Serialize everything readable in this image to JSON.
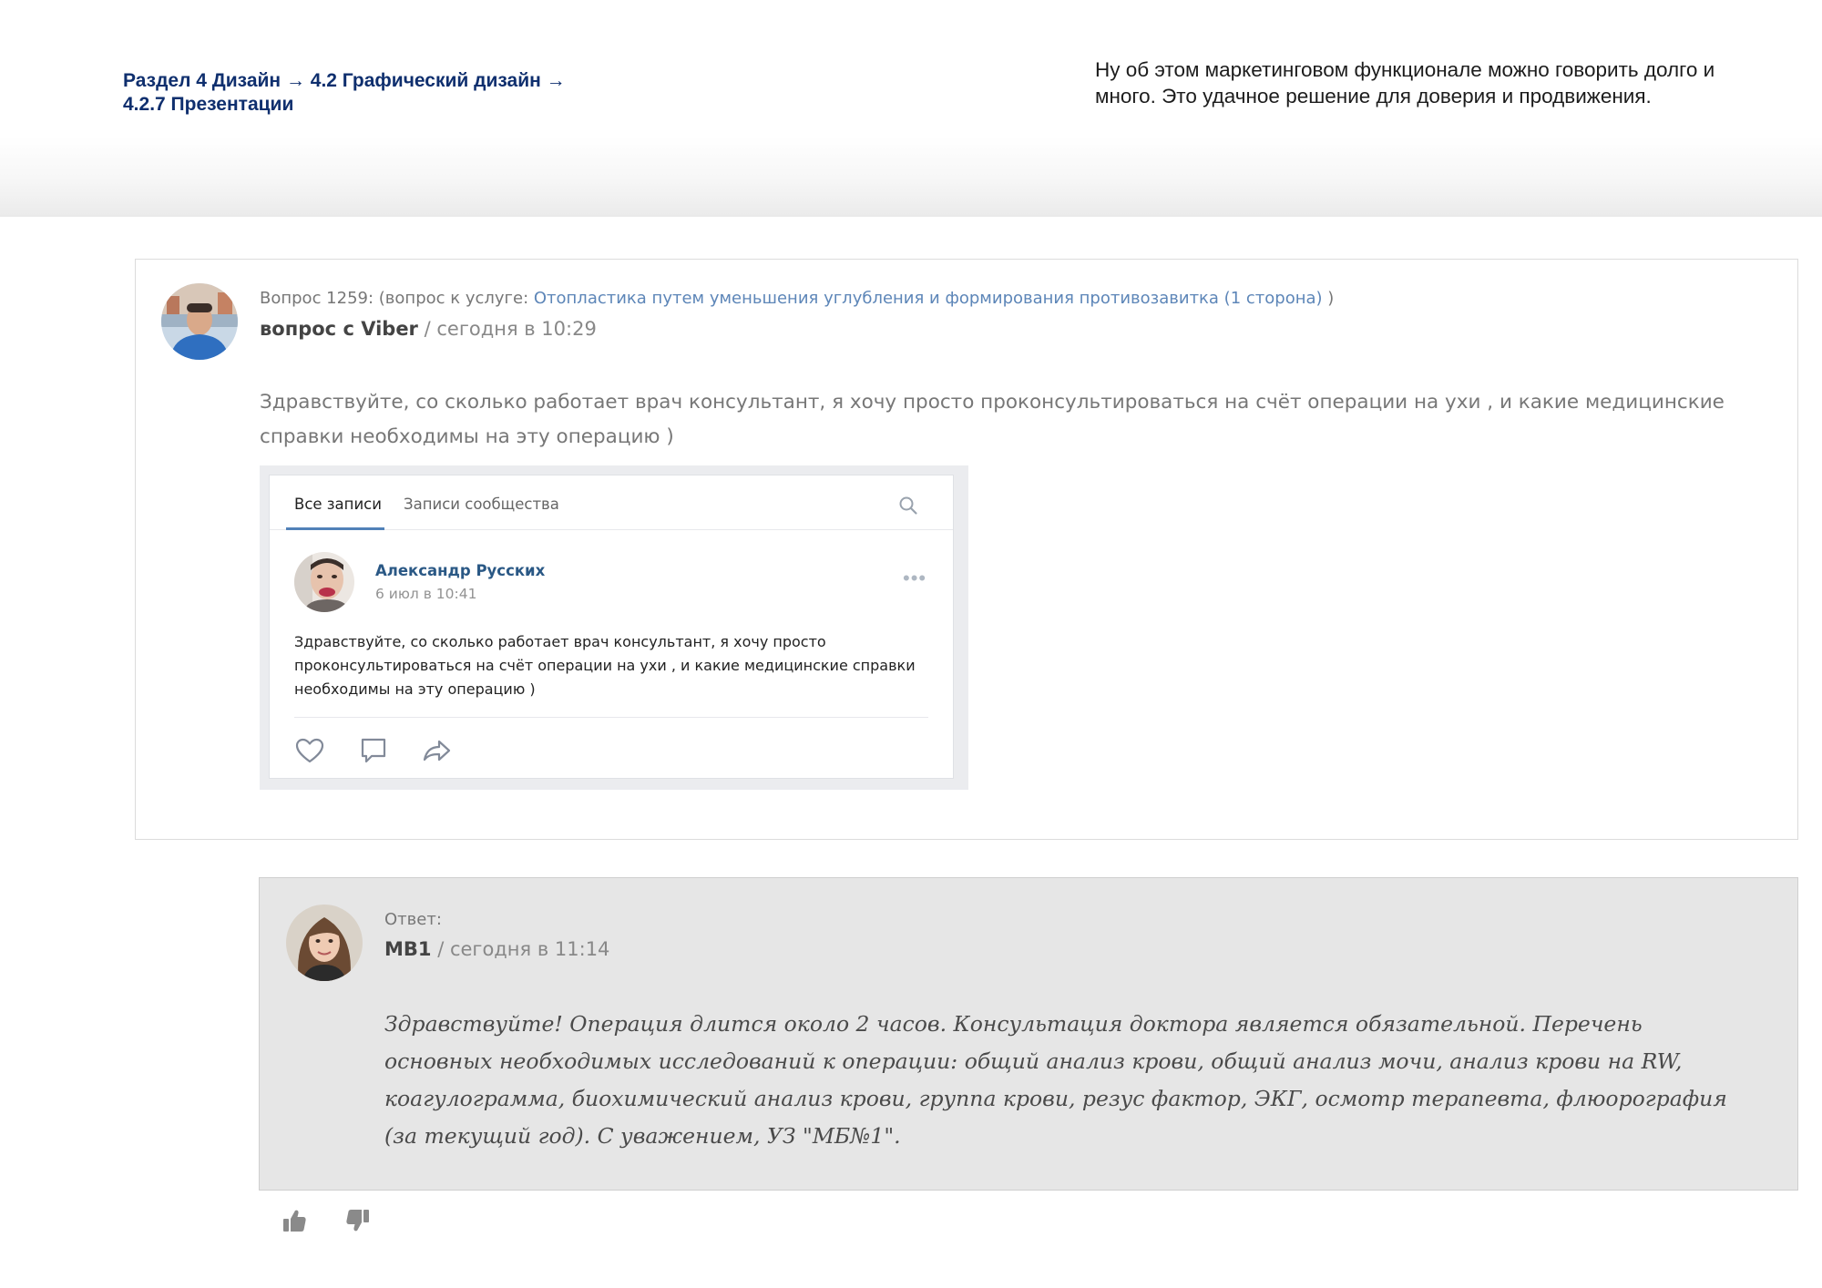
{
  "header": {
    "breadcrumb_line1": "Раздел 4 Дизайн  → 4.2 Графический дизайн →",
    "breadcrumb_line2": "4.2.7 Презентации",
    "note": "Ну об этом маркетинговом функционале можно говорить долго и много. Это удачное решение для доверия и продвижения."
  },
  "question": {
    "prefix": "Вопрос 1259: (вопрос к услуге: ",
    "service_link": "Отопластика путем уменьшения углубления и формирования противозавитка (1 сторона)",
    "suffix": " )",
    "author": "вопрос с Viber",
    "time": " / сегодня в 10:29",
    "text": "Здравствуйте, со сколько работает врач консультант, я хочу просто проконсультироваться на счёт операции на ухи , и какие медицинские справки необходимы на эту операцию )"
  },
  "vk_post": {
    "tab_all": "Все записи",
    "tab_community": "Записи сообщества",
    "author": "Александр Русских",
    "date": "6 июл в 10:41",
    "more": "•••",
    "text": "Здравствуйте, со сколько работает врач консультант, я хочу просто проконсультироваться на счёт операции на ухи , и какие медицинские справки необходимы на эту операцию )",
    "icons": [
      "search-icon",
      "heart-icon",
      "comment-icon",
      "share-icon"
    ]
  },
  "answer": {
    "label": "Ответ:",
    "author": "МВ1",
    "time": " / сегодня в 11:14",
    "text": "Здравствуйте! Операция длится около 2 часов. Консультация доктора является обязательной. Перечень основных необходимых исследований к операции: общий анализ крови, общий анализ мочи, анализ крови на RW, коагулограмма, биохимический анализ крови, группа крови, резус фактор, ЭКГ, осмотр терапевта, флюорография (за текущий год). С уважением, УЗ \"МБ№1\"."
  },
  "votes": {
    "icons": [
      "thumbs-up-icon",
      "thumbs-down-icon"
    ]
  },
  "colors": {
    "breadcrumb": "#0f2f6e",
    "link": "#5d86b8",
    "vk_blue": "#2a5885",
    "answer_bg": "#e6e6e6"
  }
}
